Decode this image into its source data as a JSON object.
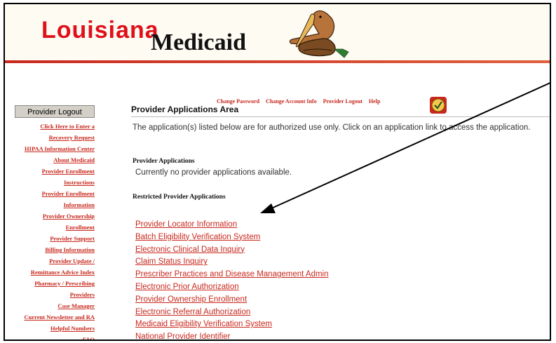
{
  "header": {
    "logo_word": "Louisiana",
    "logo_sub": "Medicaid",
    "colors": {
      "brand_red": "#e0101a",
      "link_red": "#c8281e",
      "page_bg": "#fdfbf2"
    }
  },
  "sidebar": {
    "logout_label": "Provider Logout",
    "links": [
      "Click Here to Enter a",
      "Recovery Request",
      "HIPAA Information Center",
      "About Medicaid",
      "Provider Enrollment",
      "Instructions",
      "Provider Enrollment",
      "Information",
      "Provider Ownership",
      "Enrollment",
      "Provider Support",
      "Billing Information",
      "Provider Update /",
      "Remittance Advice Index",
      "Pharmacy / Prescribing",
      "Providers",
      "Case Manager",
      "Current Newsletter and RA",
      "Helpful Numbers",
      "FAQ"
    ]
  },
  "top_links": [
    "Change Password",
    "Change Account Info",
    "Provider Logout",
    "Help"
  ],
  "main": {
    "title": "Provider Applications Area",
    "intro": "The application(s) listed below are for authorized use only. Click on an application link to access the application.",
    "provider_apps_heading": "Provider Applications",
    "no_apps_text": "Currently no provider applications available.",
    "restricted_heading": "Restricted Provider Applications",
    "restricted_apps": [
      "Provider Locator Information",
      "Batch Eligibility Verification System",
      "Electronic Clinical Data Inquiry",
      "Claim Status Inquiry",
      "Prescriber Practices and Disease Management Admin",
      "Electronic Prior Authorization",
      "Provider Ownership Enrollment",
      "Electronic Referral Authorization",
      "Medicaid Eligibility Verification System",
      "National Provider Identifier"
    ]
  },
  "icons": {
    "pelican": "pelican-logo-icon",
    "help": "help-badge-icon",
    "arrow": "callout-arrow-icon"
  }
}
